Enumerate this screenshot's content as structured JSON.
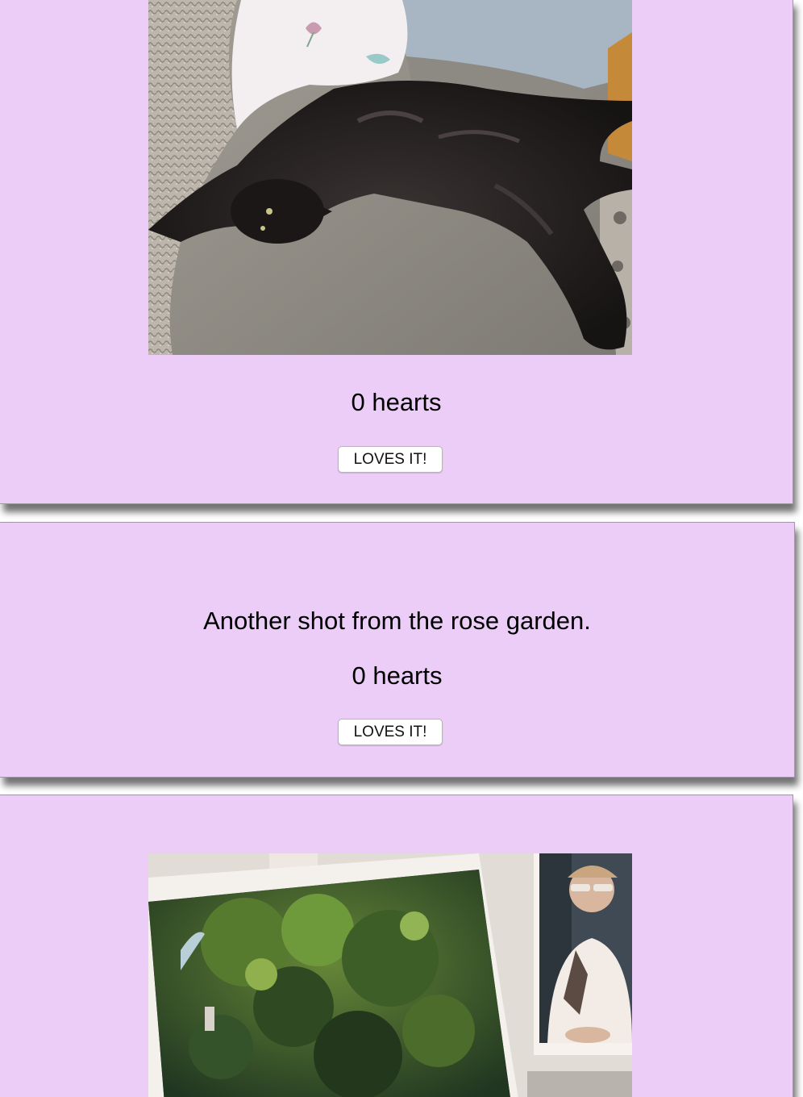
{
  "posts": [
    {
      "image": "black-cat-on-couch-photo",
      "caption": "",
      "hearts_text": "0 hearts",
      "button_label": "LOVES IT!"
    },
    {
      "image": "",
      "caption": "Another shot from the rose garden.",
      "hearts_text": "0 hearts",
      "button_label": "LOVES IT!"
    },
    {
      "image": "garden-photo-print-photo",
      "caption": "",
      "hearts_text": "",
      "button_label": ""
    }
  ],
  "colors": {
    "card_background": "#ebcdf8",
    "button_background": "#ffffff"
  }
}
